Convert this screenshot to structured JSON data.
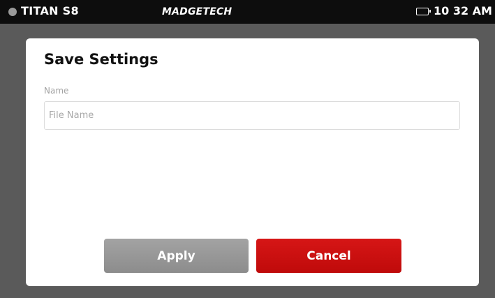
{
  "status_bar": {
    "device_name": "TITAN S8",
    "brand": "MADGETECH",
    "time": "10 32 AM",
    "battery_color": "#3fbf3f"
  },
  "dialog": {
    "title": "Save Settings",
    "name_label": "Name",
    "name_input": {
      "value": "",
      "placeholder": "File Name"
    },
    "apply_label": "Apply",
    "cancel_label": "Cancel",
    "colors": {
      "apply": "#999999",
      "cancel": "#cc1010"
    }
  }
}
